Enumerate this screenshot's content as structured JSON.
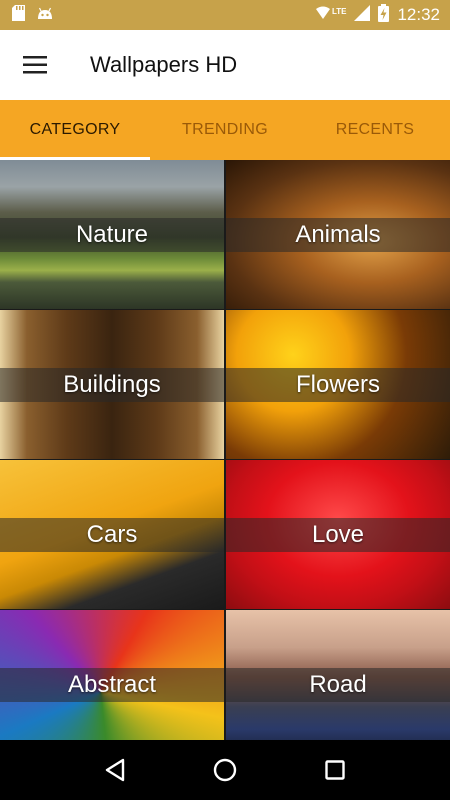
{
  "status_bar": {
    "network": "LTE",
    "time": "12:32",
    "icons": [
      "sd-card-icon",
      "android-icon",
      "wifi-icon",
      "signal-icon",
      "battery-charging-icon"
    ]
  },
  "app_bar": {
    "title": "Wallpapers HD",
    "menu_icon": "hamburger-menu-icon"
  },
  "tabs": [
    {
      "label": "CATEGORY",
      "active": true
    },
    {
      "label": "TRENDING",
      "active": false
    },
    {
      "label": "RECENTS",
      "active": false
    }
  ],
  "categories": [
    {
      "label": "Nature"
    },
    {
      "label": "Animals"
    },
    {
      "label": "Buildings"
    },
    {
      "label": "Flowers"
    },
    {
      "label": "Cars"
    },
    {
      "label": "Love"
    },
    {
      "label": "Abstract"
    },
    {
      "label": "Road"
    }
  ],
  "nav_bar": {
    "buttons": [
      "back-icon",
      "home-icon",
      "recents-icon"
    ]
  },
  "colors": {
    "status_bar": "#c7a24a",
    "tab_bar": "#f5a623",
    "app_bar": "#ffffff",
    "nav_bar": "#000000"
  }
}
